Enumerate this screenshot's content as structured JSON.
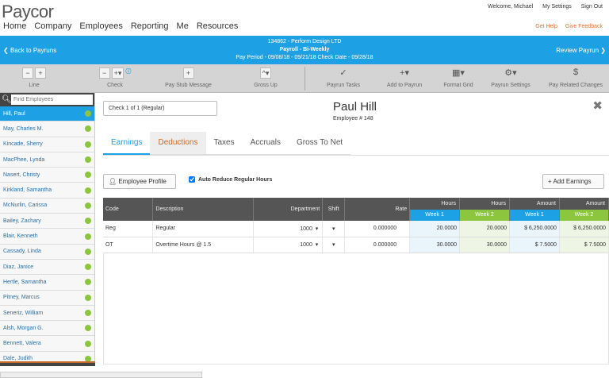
{
  "header": {
    "logo": "Paycor",
    "welcome": "Welcome, Michael",
    "my_settings": "My Settings",
    "sign_out": "Sign Out",
    "nav": [
      "Home",
      "Company",
      "Employees",
      "Reporting",
      "Me",
      "Resources"
    ],
    "get_help": "Get Help",
    "give_feedback": "Give Feedback"
  },
  "payrun": {
    "company": "134862 - Perform Design LTD",
    "payroll": "Payroll - Bi-Weekly",
    "period": "Pay Period - 09/08/18 - 09/21/18   Check Date - 09/28/18",
    "back": "Back to Payruns",
    "review": "Review Payrun"
  },
  "toolbar": {
    "line": "Line",
    "check": "Check",
    "pay_stub": "Pay Stub Message",
    "gross_up": "Gross Up",
    "payrun_tasks": "Payrun Tasks",
    "add_to_payrun": "Add to Payrun",
    "format_grid": "Format Grid",
    "payrun_settings": "Payrun Settings",
    "pay_related": "Pay Related Changes"
  },
  "sidebar": {
    "placeholder": "Find Employees",
    "employees": [
      "Hill, Paul",
      "May, Charles M.",
      "Kincade, Sherry",
      "MacPhee, Lynda",
      "Nasert, Christy",
      "Kirkland, Samantha",
      "McNurlin, Carissa",
      "Bailey, Zachary",
      "Blair, Kenneth",
      "Cassady, Linda",
      "Diaz, Janice",
      "Hertle, Samantha",
      "Pitney, Marcus",
      "Seneriz, William",
      "Alsh, Morgan G.",
      "Bennett, Valera",
      "Dale, Judith"
    ]
  },
  "main": {
    "check_select": "Check 1 of 1 (Regular)",
    "employee_name": "Paul Hill",
    "employee_number": "Employee # 148",
    "tabs": [
      "Earnings",
      "Deductions",
      "Taxes",
      "Accruals",
      "Gross To Net"
    ],
    "employee_profile": "Employee Profile",
    "auto_reduce": "Auto Reduce Regular Hours",
    "auto_reduce_checked": true,
    "add_earnings": "Add Earnings",
    "columns": {
      "code": "Code",
      "description": "Description",
      "department": "Department",
      "shift": "Shift",
      "rate": "Rate",
      "hours": "Hours",
      "amount": "Amount",
      "week1": "Week 1",
      "week2": "Week 2"
    },
    "rows": [
      {
        "code": "Reg",
        "description": "Regular",
        "department": "1000",
        "rate": "0.000000",
        "h1": "20.0000",
        "h2": "20.0000",
        "a1": "$ 6,250.0000",
        "a2": "$ 6,250.0000"
      },
      {
        "code": "OT",
        "description": "Overtime Hours @ 1.5",
        "department": "1000",
        "rate": "0.000000",
        "h1": "30.0000",
        "h2": "30.0000",
        "a1": "$ 7.5000",
        "a2": "$ 7.5000"
      }
    ]
  },
  "colors": {
    "accent_blue": "#1da1e4",
    "accent_green": "#8cc63f",
    "orange": "#e8742c"
  }
}
